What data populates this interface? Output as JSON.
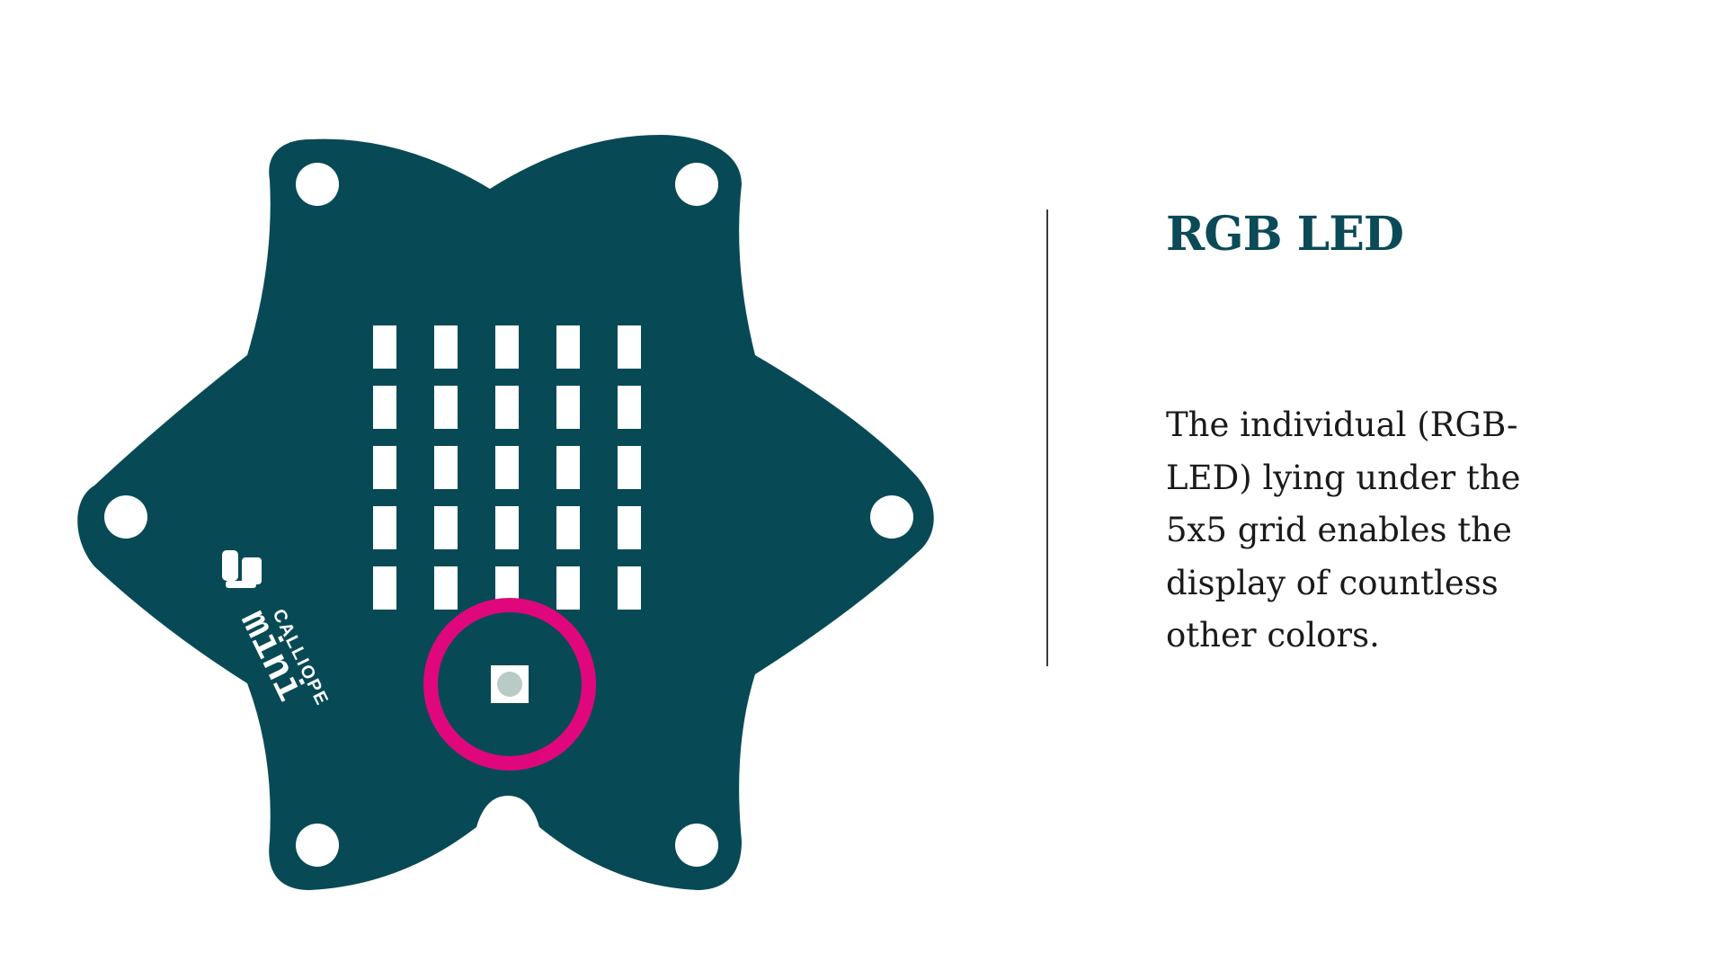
{
  "colors": {
    "board": "#074a55",
    "highlight": "#e0077d",
    "led_window": "#ffffff",
    "rgb_led": "#b8cbc6",
    "mounting_hole": "#ffffff",
    "logo": "#ffffff",
    "title": "#0b4a57",
    "text": "#1a1a1a",
    "divider": "#3a3a3a"
  },
  "board": {
    "logo_brand": "CALLIOPE",
    "logo_product": "mini",
    "led_grid": {
      "rows": 5,
      "cols": 5
    },
    "highlighted_component": "rgb-led"
  },
  "feature": {
    "title": "RGB LED",
    "description": "The individual (RGB-LED) lying under the 5x5 grid enables the display of countless other colors."
  }
}
